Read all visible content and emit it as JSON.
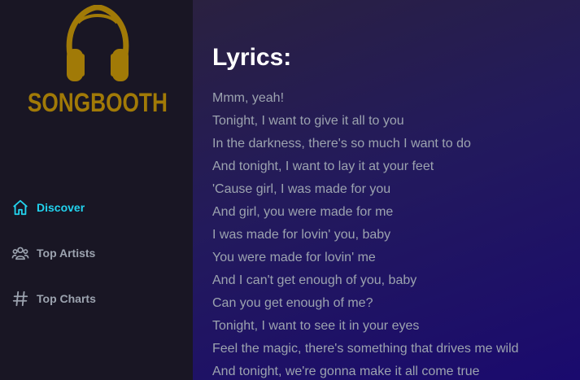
{
  "app": {
    "logo_text": "SONGBOOTH",
    "brand_color": "#a17a07",
    "accent_color": "#22d3ee"
  },
  "sidebar": {
    "items": [
      {
        "label": "Discover",
        "icon": "home-icon",
        "active": true
      },
      {
        "label": "Top Artists",
        "icon": "users-icon",
        "active": false
      },
      {
        "label": "Top Charts",
        "icon": "hashtag-icon",
        "active": false
      }
    ]
  },
  "main": {
    "heading": "Lyrics:",
    "lyrics": [
      "Mmm, yeah!",
      "Tonight, I want to give it all to you",
      "In the darkness, there's so much I want to do",
      "And tonight, I want to lay it at your feet",
      "'Cause girl, I was made for you",
      "And girl, you were made for me",
      "I was made for lovin' you, baby",
      "You were made for lovin' me",
      "And I can't get enough of you, baby",
      "Can you get enough of me?",
      "Tonight, I want to see it in your eyes",
      "Feel the magic, there's something that drives me wild",
      "And tonight, we're gonna make it all come true"
    ]
  }
}
